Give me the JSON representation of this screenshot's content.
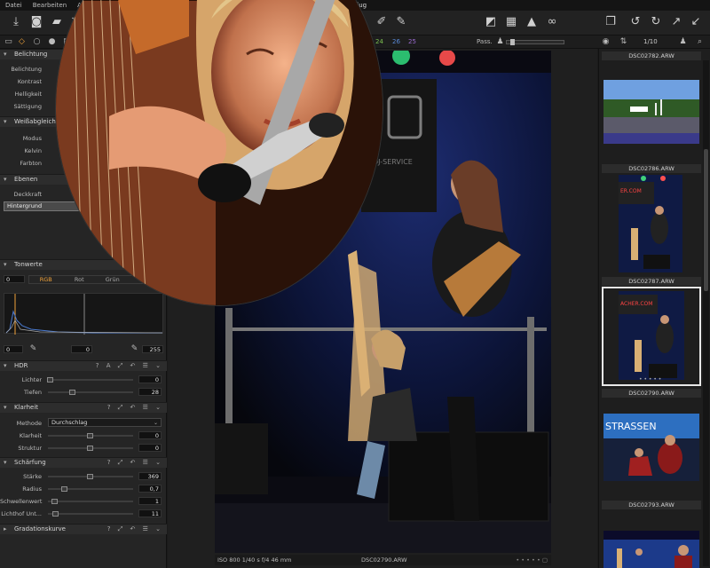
{
  "app": {
    "window_title": "Ausflug",
    "menu": [
      "Datei",
      "Bearbeiten",
      "Ansicht",
      "Ar"
    ]
  },
  "toolbar": {
    "icons": [
      "import-icon",
      "camera-icon",
      "folder-open-icon",
      "delete-icon",
      "rewind-icon",
      "eyedropper-icon",
      "eyedropper-wb-icon",
      "brush-icon",
      "eraser-icon",
      "crop-icon",
      "grid-icon",
      "warning-icon",
      "glasses-icon",
      "stack-icon",
      "undo-icon",
      "redo-icon",
      "expand-icon",
      "collapse-icon"
    ]
  },
  "tool_tabs": {
    "numbers": [
      {
        "value": "26",
        "color": "#e05050"
      },
      {
        "value": "24",
        "color": "#7dc050"
      },
      {
        "value": "26",
        "color": "#5a8ad8"
      },
      {
        "value": "25",
        "color": "#9a6ad0"
      }
    ],
    "pass_label": "Pass.",
    "pass_level": 0.12,
    "counter": "1/10"
  },
  "left": {
    "belichtung": {
      "title": "Belichtung",
      "rows": [
        "Belichtung",
        "Kontrast",
        "Helligkeit",
        "Sättigung"
      ]
    },
    "weissabgleich": {
      "title": "Weißabgleich",
      "rows": [
        "Modus",
        "Kelvin",
        "Farbton"
      ]
    },
    "ebenen": {
      "title": "Ebenen",
      "rows": [
        "Deckkraft"
      ],
      "layer": "Hintergrund"
    },
    "tonwerte": {
      "title": "Tonwerte",
      "input_low": "0",
      "channels": [
        "RGB",
        "Rot",
        "Grün",
        ""
      ],
      "active_channel": "RGB",
      "out_low": "0",
      "out_mid": "0",
      "out_high": "255"
    },
    "hdr": {
      "title": "HDR",
      "rows": [
        {
          "label": "Lichter",
          "value": "0",
          "level": 0.0
        },
        {
          "label": "Tiefen",
          "value": "28",
          "level": 0.28
        }
      ]
    },
    "klarheit": {
      "title": "Klarheit",
      "method_label": "Methode",
      "method_value": "Durchschlag",
      "rows": [
        {
          "label": "Klarheit",
          "value": "0",
          "level": 0.5
        },
        {
          "label": "Struktur",
          "value": "0",
          "level": 0.5
        }
      ]
    },
    "schaerfung": {
      "title": "Schärfung",
      "rows": [
        {
          "label": "Stärke",
          "value": "369",
          "level": 0.46
        },
        {
          "label": "Radius",
          "value": "0,7",
          "level": 0.12
        },
        {
          "label": "Schwellenwert",
          "value": "1",
          "level": 0.04
        },
        {
          "label": "Lichthof Unt...",
          "value": "11",
          "level": 0.05
        }
      ]
    },
    "gradationskurve": {
      "title": "Gradationskurve"
    }
  },
  "viewer": {
    "status_left": "ISO 800  1/40 s  f/4  46 mm",
    "status_file": "DSC02790.ARW"
  },
  "browser": {
    "thumbs": [
      {
        "name": "DSC02782.ARW"
      },
      {
        "name": "DSC02786.ARW"
      },
      {
        "name": "DSC02787.ARW"
      },
      {
        "name": "DSC02790.ARW"
      },
      {
        "name": "DSC02793.ARW"
      }
    ]
  }
}
